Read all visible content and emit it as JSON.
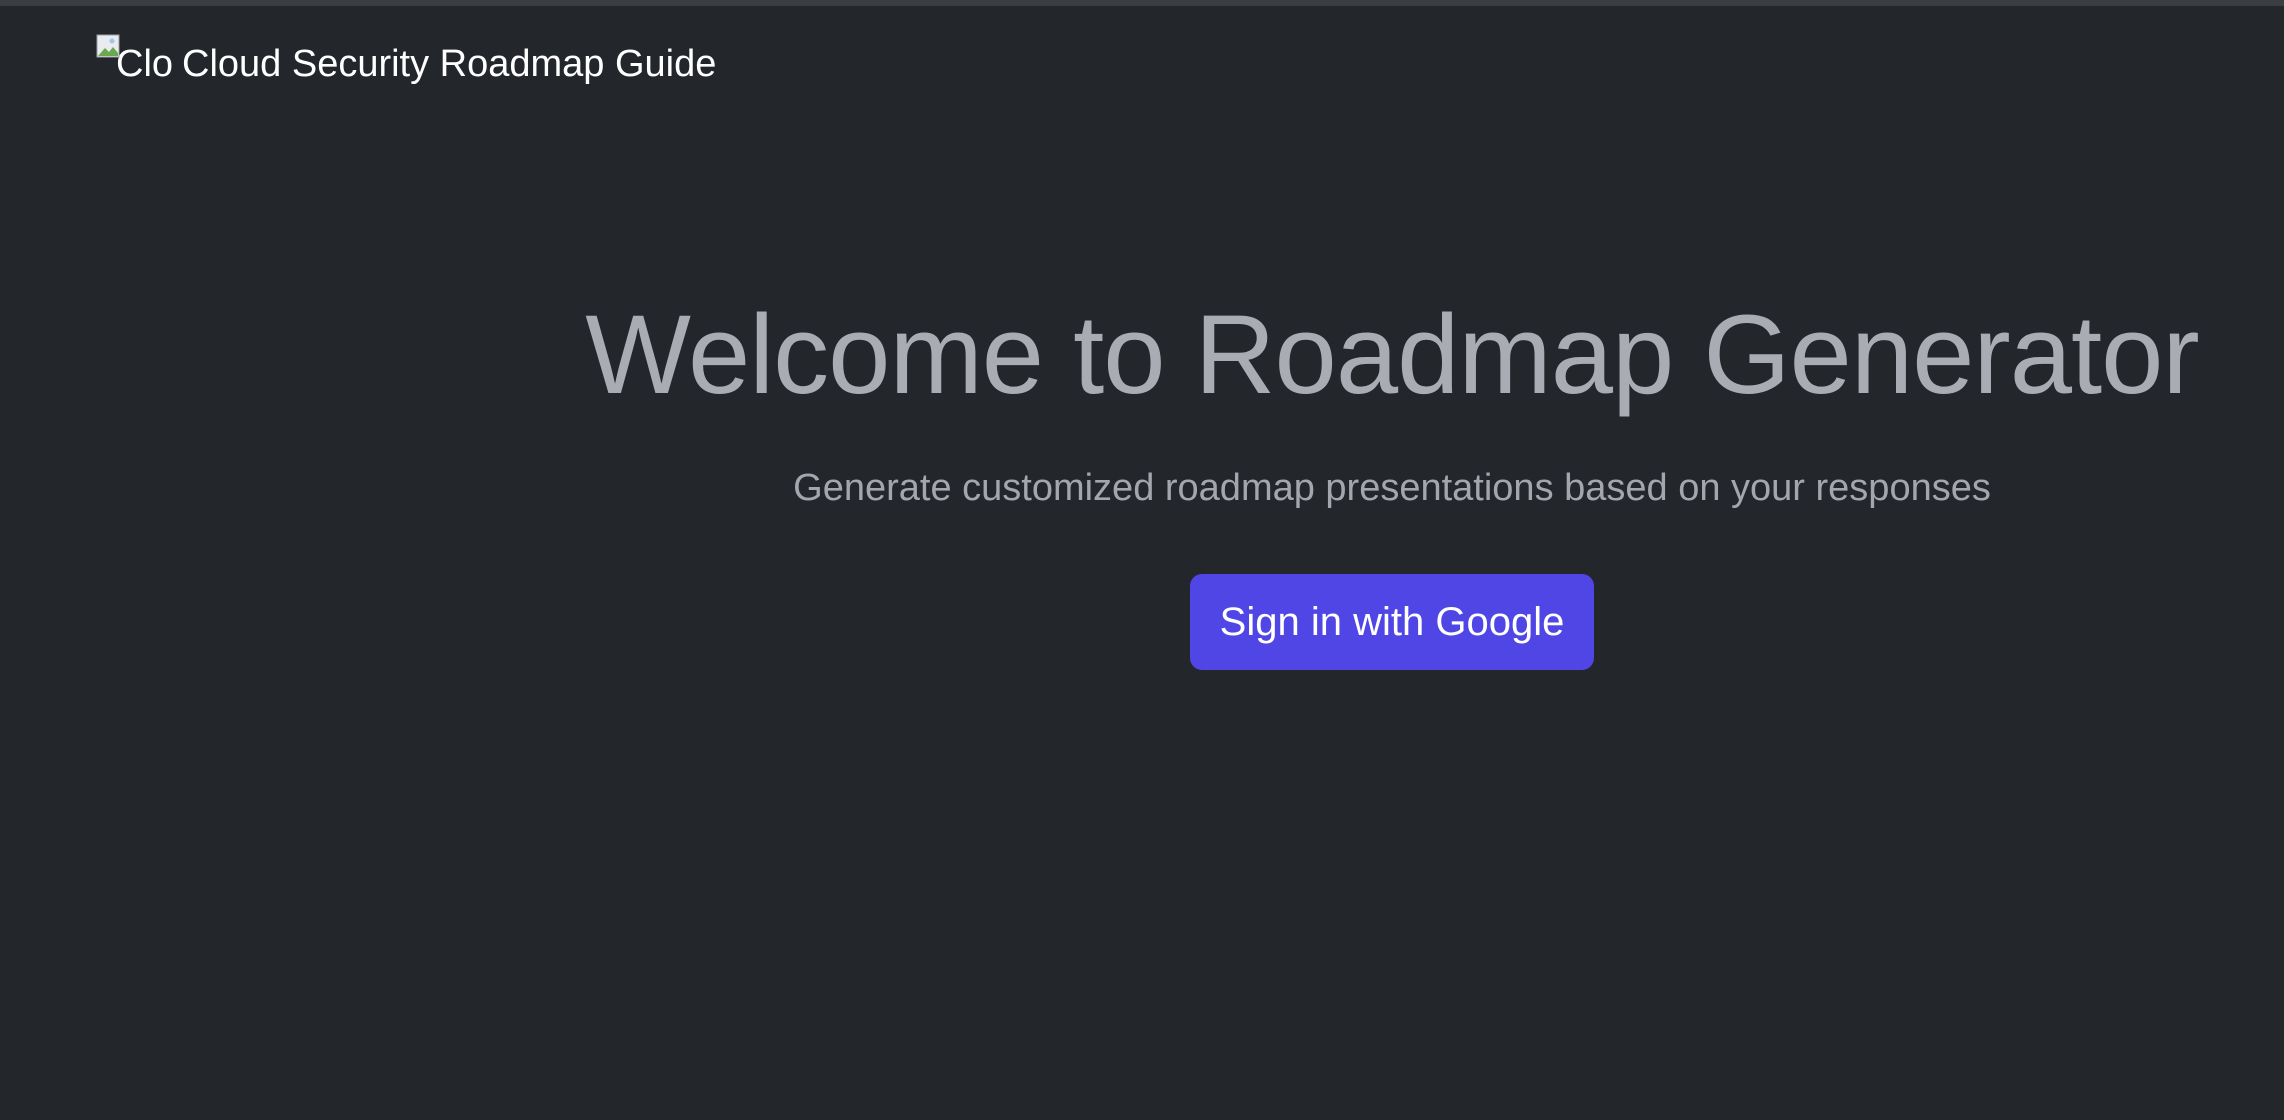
{
  "header": {
    "logo_alt": "Clo",
    "title": "Cloud Security Roadmap Guide"
  },
  "hero": {
    "title": "Welcome to Roadmap Generator",
    "subtitle": "Generate customized roadmap presentations based on your responses",
    "signin_label": "Sign in with Google"
  },
  "colors": {
    "background": "#23262b",
    "accent": "#4f46e5",
    "title_text": "#a9adb3"
  },
  "icons": {
    "logo": "broken-image-icon"
  }
}
